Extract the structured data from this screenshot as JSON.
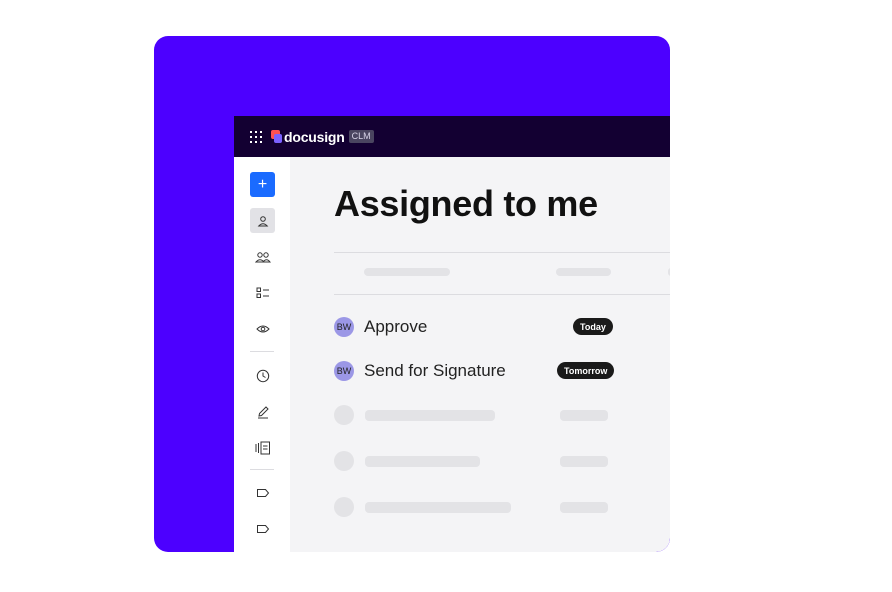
{
  "brand": {
    "name": "docusign",
    "badge": "CLM"
  },
  "colors": {
    "background_card": "#4c00ff",
    "topbar": "#130032",
    "primary_button": "#1a6bff",
    "avatar": "#9b97e6"
  },
  "sidebar": {
    "create_label": "+",
    "items": [
      {
        "icon": "person-icon"
      },
      {
        "icon": "people-icon"
      },
      {
        "icon": "checklist-icon"
      },
      {
        "icon": "eye-icon"
      },
      {
        "icon": "clock-icon"
      },
      {
        "icon": "pen-icon"
      },
      {
        "icon": "documents-icon"
      },
      {
        "icon": "tag-icon"
      },
      {
        "icon": "tag-icon"
      }
    ]
  },
  "main": {
    "title": "Assigned to me",
    "tasks": [
      {
        "initials": "BW",
        "name": "Approve",
        "due": "Today"
      },
      {
        "initials": "BW",
        "name": "Send for Signature",
        "due": "Tomorrow"
      }
    ]
  }
}
